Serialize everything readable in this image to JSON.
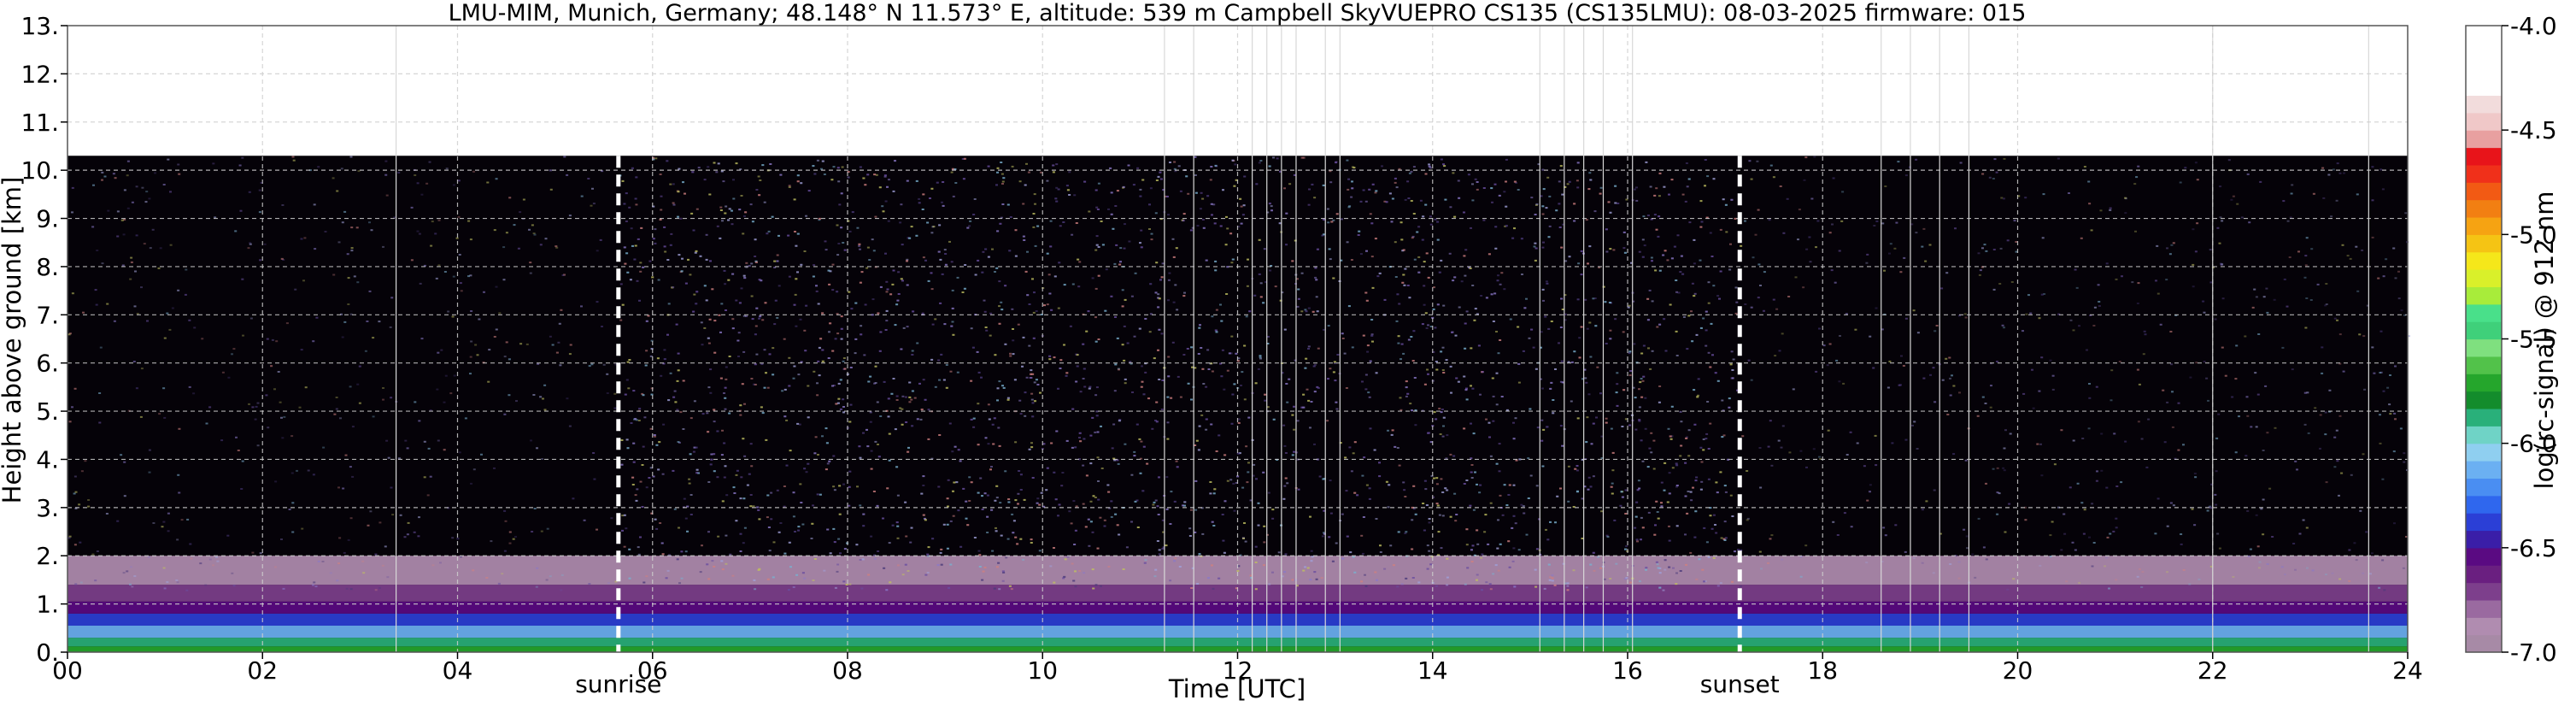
{
  "chart_data": {
    "type": "heatmap",
    "title": "LMU-MIM, Munich, Germany; 48.148° N 11.573° E, altitude: 539 m    Campbell SkyVUEPRO CS135 (CS135LMU): 08-03-2025    firmware: 015",
    "xlabel": "Time [UTC]",
    "ylabel": "Height above ground [km]",
    "xlim": [
      0,
      24
    ],
    "ylim": [
      0,
      13
    ],
    "x_ticks": [
      {
        "value": 0,
        "label": "00"
      },
      {
        "value": 2,
        "label": "02"
      },
      {
        "value": 4,
        "label": "04"
      },
      {
        "value": 6,
        "label": "06"
      },
      {
        "value": 8,
        "label": "08"
      },
      {
        "value": 10,
        "label": "10"
      },
      {
        "value": 12,
        "label": "12"
      },
      {
        "value": 14,
        "label": "14"
      },
      {
        "value": 16,
        "label": "16"
      },
      {
        "value": 18,
        "label": "18"
      },
      {
        "value": 20,
        "label": "20"
      },
      {
        "value": 22,
        "label": "22"
      },
      {
        "value": 24,
        "label": "24"
      }
    ],
    "y_ticks": [
      {
        "value": 0,
        "label": "0."
      },
      {
        "value": 1,
        "label": "1."
      },
      {
        "value": 2,
        "label": "2."
      },
      {
        "value": 3,
        "label": "3."
      },
      {
        "value": 4,
        "label": "4."
      },
      {
        "value": 5,
        "label": "5."
      },
      {
        "value": 6,
        "label": "6."
      },
      {
        "value": 7,
        "label": "7."
      },
      {
        "value": 8,
        "label": "8."
      },
      {
        "value": 9,
        "label": "9."
      },
      {
        "value": 10,
        "label": "10."
      },
      {
        "value": 11,
        "label": "11."
      },
      {
        "value": 12,
        "label": "12."
      },
      {
        "value": 13,
        "label": "13."
      }
    ],
    "grid": true,
    "data_top_km": 10.3,
    "markers": [
      {
        "label": "sunrise",
        "time": 5.65
      },
      {
        "label": "sunset",
        "time": 17.15
      }
    ],
    "layers": [
      {
        "from_km": 0.0,
        "to_km": 0.12,
        "level": -5.7
      },
      {
        "from_km": 0.12,
        "to_km": 0.3,
        "level": -5.9
      },
      {
        "from_km": 0.3,
        "to_km": 0.55,
        "level": -6.1
      },
      {
        "from_km": 0.55,
        "to_km": 0.8,
        "level": -6.35
      },
      {
        "from_km": 0.8,
        "to_km": 1.05,
        "level": -6.55
      },
      {
        "from_km": 1.05,
        "to_km": 1.4,
        "level": -6.75
      },
      {
        "from_km": 1.4,
        "to_km": 2.0,
        "level": -6.9
      }
    ],
    "colorbar": {
      "label": "log(rc-signal) @ 912 nm",
      "min": -7.0,
      "max": -4.0,
      "ticks": [
        {
          "value": -4.0,
          "label": "-4.0"
        },
        {
          "value": -4.5,
          "label": "-4.5"
        },
        {
          "value": -5.0,
          "label": "-5.0"
        },
        {
          "value": -5.5,
          "label": "-5.5"
        },
        {
          "value": -6.0,
          "label": "-6.0"
        },
        {
          "value": -6.5,
          "label": "-6.5"
        },
        {
          "value": -7.0,
          "label": "-7.0"
        }
      ],
      "colors": [
        "#a78aa6",
        "#b08cb0",
        "#9a6aa0",
        "#7d3f8c",
        "#6a1f80",
        "#5a0a82",
        "#3a1ea8",
        "#2b3fd6",
        "#2f67ee",
        "#4a8ef2",
        "#6bb0f2",
        "#8fcff0",
        "#6fd3c6",
        "#29b07a",
        "#138c2c",
        "#25a62c",
        "#52c24a",
        "#7fe07f",
        "#3fd07a",
        "#49e08a",
        "#a8ec3a",
        "#d9f02a",
        "#f5e71a",
        "#f5c414",
        "#f6a312",
        "#f27f12",
        "#f25a14",
        "#f0301a",
        "#e8141a",
        "#e8a0a0",
        "#f0c8c8",
        "#f2dcdc",
        "#ffffff",
        "#ffffff",
        "#ffffff",
        "#ffffff"
      ]
    }
  }
}
